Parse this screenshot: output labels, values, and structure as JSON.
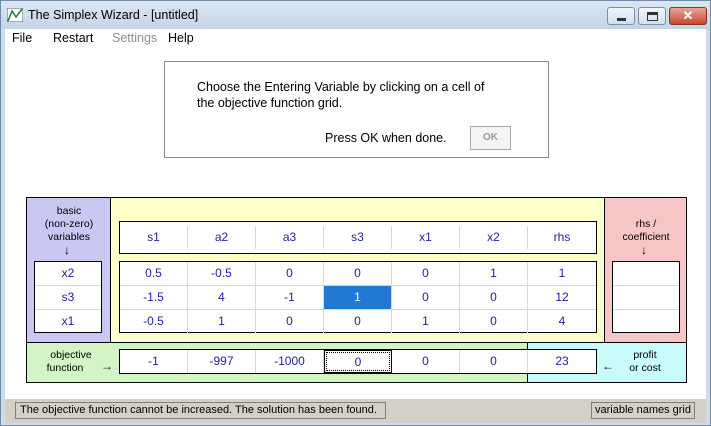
{
  "window": {
    "title": "The Simplex Wizard - [untitled]",
    "close_glyph": "✕"
  },
  "menu": {
    "items": [
      {
        "label": "File"
      },
      {
        "label": "Restart"
      },
      {
        "label": "Settings",
        "disabled": true
      },
      {
        "label": "Help"
      }
    ]
  },
  "instructions": {
    "line1": "Choose the Entering Variable  by clicking on a cell of",
    "line2": "the objective function grid.",
    "press_text": "Press OK when done.",
    "ok_label": "OK"
  },
  "tableau": {
    "basic_label": [
      "basic",
      "(non-zero)",
      "variables"
    ],
    "ratio_label": [
      "rhs /",
      "coefficient"
    ],
    "objective_label": [
      "objective",
      "function"
    ],
    "profit_label": [
      "profit",
      "or cost"
    ],
    "down_arrow": "↓",
    "right_arrow": "→",
    "left_arrow": "←",
    "column_headers": [
      "s1",
      "a2",
      "a3",
      "s3",
      "x1",
      "x2",
      "rhs"
    ],
    "basic_variables": [
      "x2",
      "s3",
      "x1"
    ],
    "rows": [
      [
        "0.5",
        "-0.5",
        "0",
        "0",
        "0",
        "1",
        "1"
      ],
      [
        "-1.5",
        "4",
        "-1",
        "1",
        "0",
        "0",
        "12"
      ],
      [
        "-0.5",
        "1",
        "0",
        "0",
        "1",
        "0",
        "4"
      ]
    ],
    "objective_row": [
      "-1",
      "-997",
      "-1000",
      "0",
      "0",
      "0"
    ],
    "objective_rhs": "23",
    "selected_cell": {
      "row": 1,
      "column": "s3"
    },
    "focused_objective_column": "s3"
  },
  "status": {
    "message": "The objective function cannot be increased.  The solution has been found.",
    "mode": "variable names grid"
  },
  "colors": {
    "basic_panel": "#c9c8f2",
    "main_panel": "#ffffcc",
    "ratio_panel": "#f6c6c6",
    "objective_panel": "#d3f5c5",
    "profit_panel": "#c9fbfb",
    "selected_cell": "#1f78d1",
    "value_text": "#1f1f9e"
  }
}
